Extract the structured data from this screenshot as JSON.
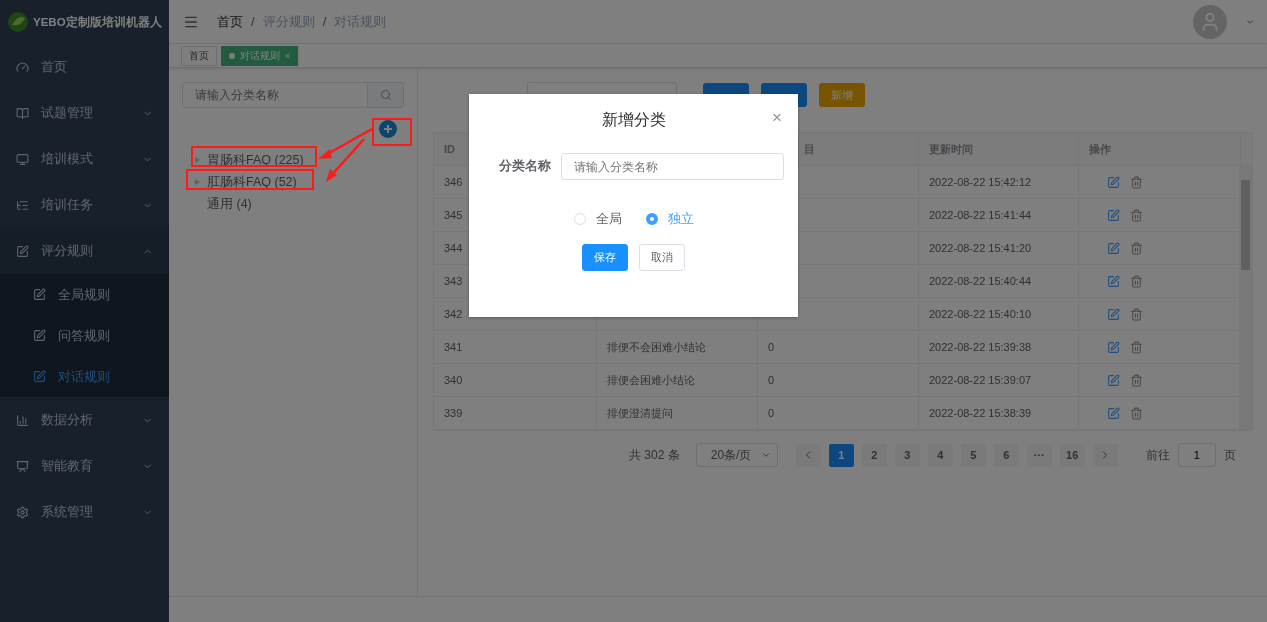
{
  "app": {
    "title": "YEBO定制版培训机器人"
  },
  "sidebar": {
    "items": [
      {
        "label": "首页",
        "kind": "link"
      },
      {
        "label": "试题管理",
        "kind": "group",
        "expanded": false
      },
      {
        "label": "培训模式",
        "kind": "group",
        "expanded": false
      },
      {
        "label": "培训任务",
        "kind": "group",
        "expanded": false
      },
      {
        "label": "评分规则",
        "kind": "group",
        "expanded": true,
        "children": [
          {
            "label": "全局规则",
            "selected": false
          },
          {
            "label": "问答规则",
            "selected": false
          },
          {
            "label": "对话规则",
            "selected": true
          }
        ]
      },
      {
        "label": "数据分析",
        "kind": "group",
        "expanded": false
      },
      {
        "label": "智能教育",
        "kind": "group",
        "expanded": false
      },
      {
        "label": "系统管理",
        "kind": "group",
        "expanded": false
      }
    ]
  },
  "breadcrumb": {
    "items": [
      "首页",
      "评分规则",
      "对话规则"
    ],
    "separator": "/"
  },
  "tags": [
    {
      "label": "首页",
      "selected": false
    },
    {
      "label": "对话规则",
      "selected": true,
      "close": "×"
    }
  ],
  "category_panel": {
    "search": {
      "placeholder": "请输入分类名称"
    },
    "tree": [
      {
        "label": "胃肠科FAQ (225)",
        "kind": "branch",
        "expanded": false,
        "highlighted": true
      },
      {
        "label": "肛肠科FAQ (52)",
        "kind": "branch",
        "expanded": false,
        "highlighted": true
      },
      {
        "label": "通用 (4)",
        "kind": "leaf",
        "highlighted": false
      }
    ]
  },
  "filter": {
    "new_button": "新增"
  },
  "table": {
    "columns": [
      "ID",
      "目",
      "更新时间",
      "操作"
    ],
    "rows": [
      {
        "id": "346",
        "name": "",
        "count": "",
        "updated": "2022-08-22 15:42:12"
      },
      {
        "id": "345",
        "name": "",
        "count": "",
        "updated": "2022-08-22 15:41:44"
      },
      {
        "id": "344",
        "name": "",
        "count": "",
        "updated": "2022-08-22 15:41:20"
      },
      {
        "id": "343",
        "name": "",
        "count": "",
        "updated": "2022-08-22 15:40:44"
      },
      {
        "id": "342",
        "name": "",
        "count": "",
        "updated": "2022-08-22 15:40:10"
      },
      {
        "id": "341",
        "name": "排便不会困难小结论",
        "count": "0",
        "updated": "2022-08-22 15:39:38"
      },
      {
        "id": "340",
        "name": "排便会困难小结论",
        "count": "0",
        "updated": "2022-08-22 15:39:07"
      },
      {
        "id": "339",
        "name": "排便澄清提问",
        "count": "0",
        "updated": "2022-08-22 15:38:39"
      }
    ]
  },
  "pagination": {
    "total": "共 302 条",
    "page_size": "20条/页",
    "pages": [
      {
        "label": "1",
        "selected": true
      },
      {
        "label": "2",
        "selected": false
      },
      {
        "label": "3",
        "selected": false
      },
      {
        "label": "4",
        "selected": false
      },
      {
        "label": "5",
        "selected": false
      },
      {
        "label": "6",
        "selected": false
      },
      {
        "label": "···",
        "selected": false
      },
      {
        "label": "16",
        "selected": false
      }
    ],
    "goto_label": "前往",
    "goto_value": "1",
    "goto_suffix": "页"
  },
  "dialog": {
    "title": "新增分类",
    "close": "×",
    "field_label": "分类名称",
    "placeholder": "请输入分类名称",
    "options": [
      {
        "label": "全局",
        "selected": false
      },
      {
        "label": "独立",
        "selected": true
      }
    ],
    "buttons": [
      {
        "label": "保存",
        "kind": "primary"
      },
      {
        "label": "取消",
        "kind": "default"
      }
    ]
  }
}
